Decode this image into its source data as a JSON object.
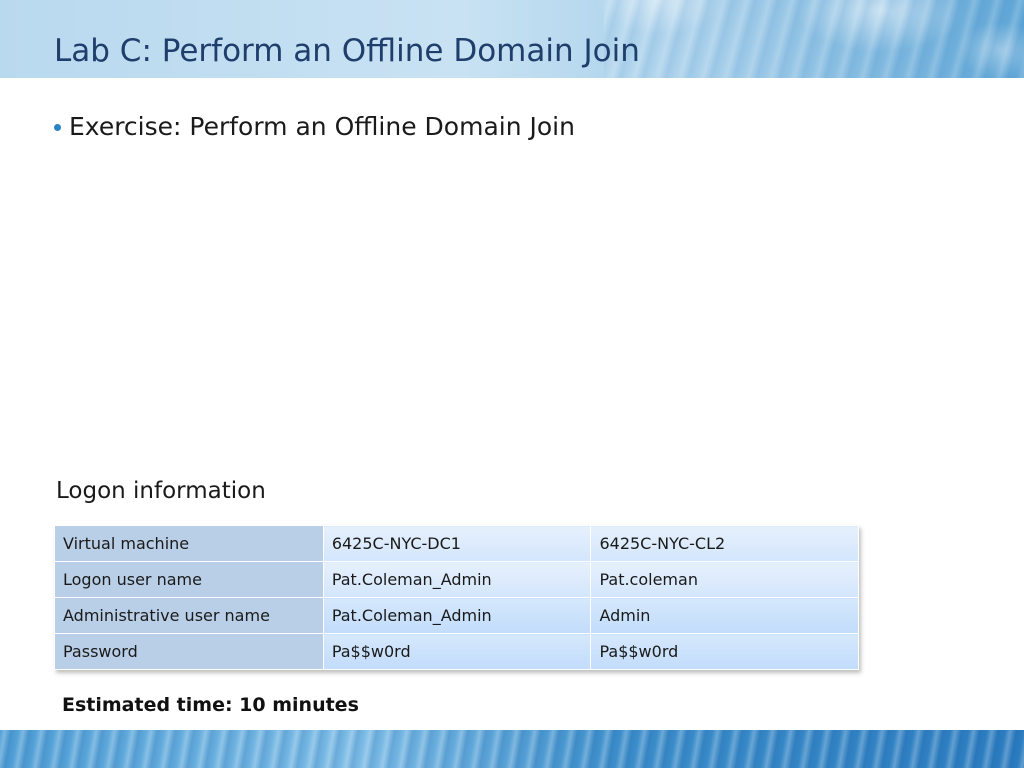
{
  "slide": {
    "title": "Lab C: Perform an Offline Domain Join",
    "bullets": [
      "Exercise: Perform an Offline Domain Join"
    ],
    "section_heading": "Logon information",
    "table": {
      "rows": [
        [
          "Virtual machine",
          "6425C-NYC-DC1",
          "6425C-NYC-CL2"
        ],
        [
          "Logon user name",
          "Pat.Coleman_Admin",
          "Pat.coleman"
        ],
        [
          "Administrative user name",
          "Pat.Coleman_Admin",
          "Admin"
        ],
        [
          "Password",
          "Pa$$w0rd",
          "Pa$$w0rd"
        ]
      ]
    },
    "estimated_time": "Estimated time: 10 minutes"
  },
  "colors": {
    "title": "#1f3e6b",
    "bullet": "#2a83c4",
    "label_cell": "#b9cfe7",
    "value_cell": "#d3e6fc"
  }
}
